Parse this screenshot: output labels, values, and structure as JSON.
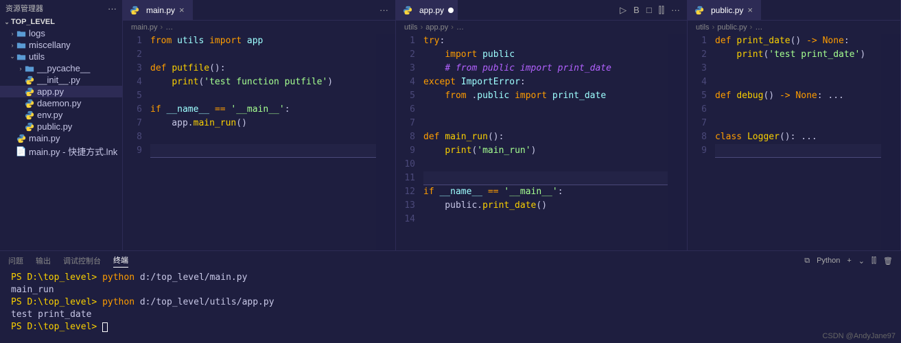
{
  "sidebar": {
    "title": "资源管理器",
    "root": "TOP_LEVEL",
    "items": [
      {
        "label": "logs",
        "type": "folder",
        "indent": 1,
        "chev": "›"
      },
      {
        "label": "miscellany",
        "type": "folder",
        "indent": 1,
        "chev": "›"
      },
      {
        "label": "utils",
        "type": "folder",
        "indent": 1,
        "chev": "⌄",
        "open": true
      },
      {
        "label": "__pycache__",
        "type": "folder",
        "indent": 2,
        "chev": "›"
      },
      {
        "label": "__init__.py",
        "type": "py",
        "indent": 2
      },
      {
        "label": "app.py",
        "type": "py",
        "indent": 2,
        "sel": true
      },
      {
        "label": "daemon.py",
        "type": "py",
        "indent": 2
      },
      {
        "label": "env.py",
        "type": "py",
        "indent": 2
      },
      {
        "label": "public.py",
        "type": "py",
        "indent": 2
      },
      {
        "label": "main.py",
        "type": "py",
        "indent": 1
      },
      {
        "label": "main.py - 快捷方式.lnk",
        "type": "lnk",
        "indent": 1
      }
    ]
  },
  "panes": [
    {
      "tab": "main.py",
      "close": "×",
      "actions": [
        "···"
      ],
      "crumbs": [
        "",
        "main.py",
        "…"
      ],
      "code": [
        {
          "html": "<span class='k'>from</span> <span class='n'>utils</span> <span class='k'>import</span> <span class='n'>app</span>"
        },
        {
          "html": ""
        },
        {
          "html": "<span class='k'>def</span> <span class='d'>putfile</span>():"
        },
        {
          "html": "    <span class='fn'>print</span>(<span class='s'>'test function putfile'</span>)"
        },
        {
          "html": ""
        },
        {
          "html": "<span class='k'>if</span> <span class='n'>__name__</span> <span class='op'>==</span> <span class='s'>'__main__'</span>:"
        },
        {
          "html": "    app.<span class='fn'>main_run</span>()"
        },
        {
          "html": ""
        },
        {
          "html": "",
          "cur": true
        }
      ]
    },
    {
      "tab": "app.py",
      "close": "×",
      "dirty": true,
      "actions": [
        "▷",
        "B",
        "□",
        "⫿⫿",
        "···"
      ],
      "crumbs": [
        "utils",
        "app.py",
        "…"
      ],
      "code": [
        {
          "html": "<span class='k'>try</span>:"
        },
        {
          "html": "    <span class='k'>import</span> <span class='n'>public</span>"
        },
        {
          "html": "    <span class='c'># from public import print_date</span>"
        },
        {
          "html": "<span class='k'>except</span> <span class='n'>ImportError</span>:"
        },
        {
          "html": "    <span class='k'>from</span> .<span class='n'>public</span> <span class='k'>import</span> <span class='n'>print_date</span>"
        },
        {
          "html": ""
        },
        {
          "html": ""
        },
        {
          "html": "<span class='k'>def</span> <span class='d'>main_run</span>():"
        },
        {
          "html": "    <span class='fn'>print</span>(<span class='s'>'main_run'</span>)"
        },
        {
          "html": ""
        },
        {
          "html": "",
          "cur": true
        },
        {
          "html": "<span class='k'>if</span> <span class='n'>__name__</span> <span class='op'>==</span> <span class='s'>'__main__'</span>:"
        },
        {
          "html": "    public.<span class='fn'>print_date</span>()"
        },
        {
          "html": ""
        }
      ]
    },
    {
      "tab": "public.py",
      "close": "×",
      "crumbs": [
        "utils",
        "public.py",
        "…"
      ],
      "code": [
        {
          "html": "<span class='k'>def</span> <span class='d'>print_date</span>() <span class='op'>-&gt;</span> <span class='k'>None</span>:"
        },
        {
          "html": "    <span class='fn'>print</span>(<span class='s'>'test print_date'</span>)"
        },
        {
          "html": ""
        },
        {
          "html": ""
        },
        {
          "html": "<span class='k'>def</span> <span class='d'>debug</span>() <span class='op'>-&gt;</span> <span class='k'>None</span>: ..."
        },
        {
          "html": ""
        },
        {
          "html": ""
        },
        {
          "html": "<span class='k'>class</span> <span class='d'>Logger</span>(): ..."
        },
        {
          "html": "",
          "cur": true
        }
      ]
    }
  ],
  "panel": {
    "tabs": [
      "问题",
      "输出",
      "调试控制台",
      "终端"
    ],
    "active": 3,
    "right": {
      "lang": "Python"
    },
    "lines": [
      {
        "prompt": "PS D:\\top_level>",
        "cmd": "python",
        "args": "d:/top_level/main.py"
      },
      {
        "out": "main_run"
      },
      {
        "prompt": "PS D:\\top_level>",
        "cmd": "python",
        "args": "d:/top_level/utils/app.py"
      },
      {
        "out": "test print_date"
      },
      {
        "prompt": "PS D:\\top_level>",
        "cursor": true
      }
    ]
  },
  "watermark": "CSDN @AndyJane97"
}
